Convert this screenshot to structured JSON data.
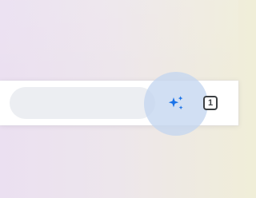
{
  "toolbar": {
    "search_placeholder": "",
    "ai_button_icon": "sparkle-icon",
    "tab_count": "1"
  },
  "colors": {
    "background_left": "#ebe0f1",
    "background_right": "#f0eed8",
    "toolbar_background": "#ffffff",
    "search_pill": "#eceef2",
    "ai_highlight": "#c4d6f0",
    "sparkle_icon": "#1a73e8",
    "tab_counter_border": "#3c4043"
  }
}
